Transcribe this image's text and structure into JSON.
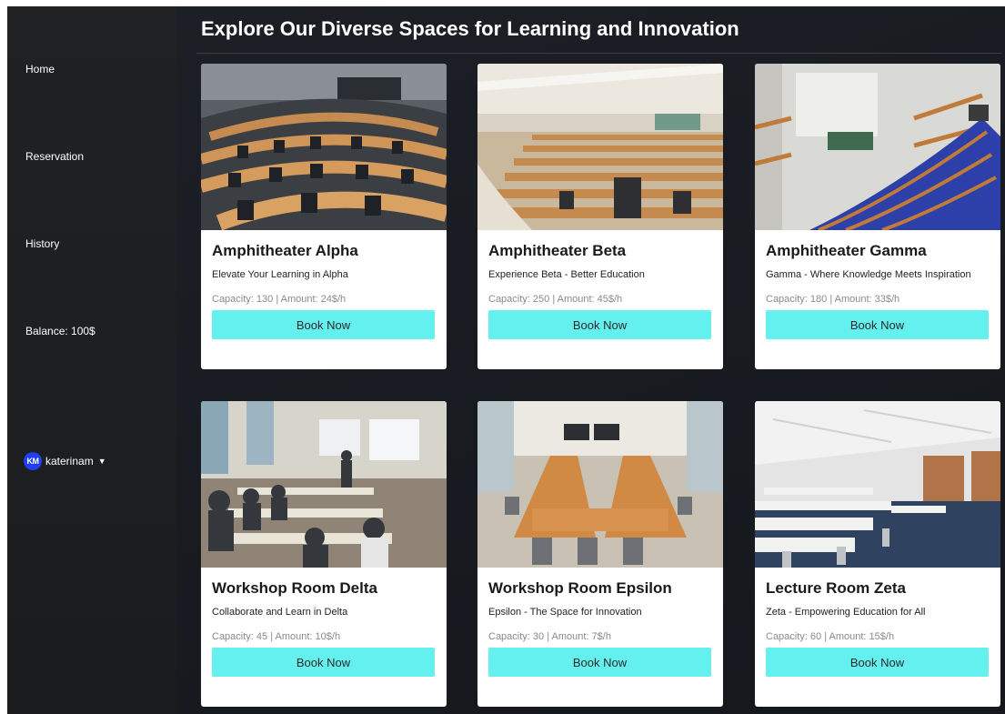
{
  "sidebar": {
    "nav": [
      {
        "label": "Home"
      },
      {
        "label": "Reservation"
      },
      {
        "label": "History"
      }
    ],
    "balance": "Balance: 100$",
    "user": {
      "initials": "KM",
      "name": "katerinam",
      "avatar_color": "#1f3ff0"
    }
  },
  "main": {
    "title": "Explore Our Diverse Spaces for Learning and Innovation",
    "button_color": "#63f0ee",
    "rooms": [
      {
        "name": "Amphitheater Alpha",
        "tagline": "Elevate Your Learning in Alpha",
        "meta": "Capacity: 130 | Amount: 24$/h",
        "button": "Book Now",
        "image": "amphitheater-alpha-photo"
      },
      {
        "name": "Amphitheater Beta",
        "tagline": "Experience Beta - Better Education",
        "meta": "Capacity: 250 | Amount: 45$/h",
        "button": "Book Now",
        "image": "amphitheater-beta-photo"
      },
      {
        "name": "Amphitheater Gamma",
        "tagline": "Gamma - Where Knowledge Meets Inspiration",
        "meta": "Capacity: 180 | Amount: 33$/h",
        "button": "Book Now",
        "image": "amphitheater-gamma-photo"
      },
      {
        "name": "Workshop Room Delta",
        "tagline": "Collaborate and Learn in Delta",
        "meta": "Capacity: 45 | Amount: 10$/h",
        "button": "Book Now",
        "image": "workshop-room-delta-photo"
      },
      {
        "name": "Workshop Room Epsilon",
        "tagline": "Epsilon - The Space for Innovation",
        "meta": "Capacity: 30 | Amount: 7$/h",
        "button": "Book Now",
        "image": "workshop-room-epsilon-photo"
      },
      {
        "name": "Lecture Room Zeta",
        "tagline": "Zeta - Empowering Education for All",
        "meta": "Capacity: 60 | Amount: 15$/h",
        "button": "Book Now",
        "image": "lecture-room-zeta-photo"
      }
    ]
  }
}
